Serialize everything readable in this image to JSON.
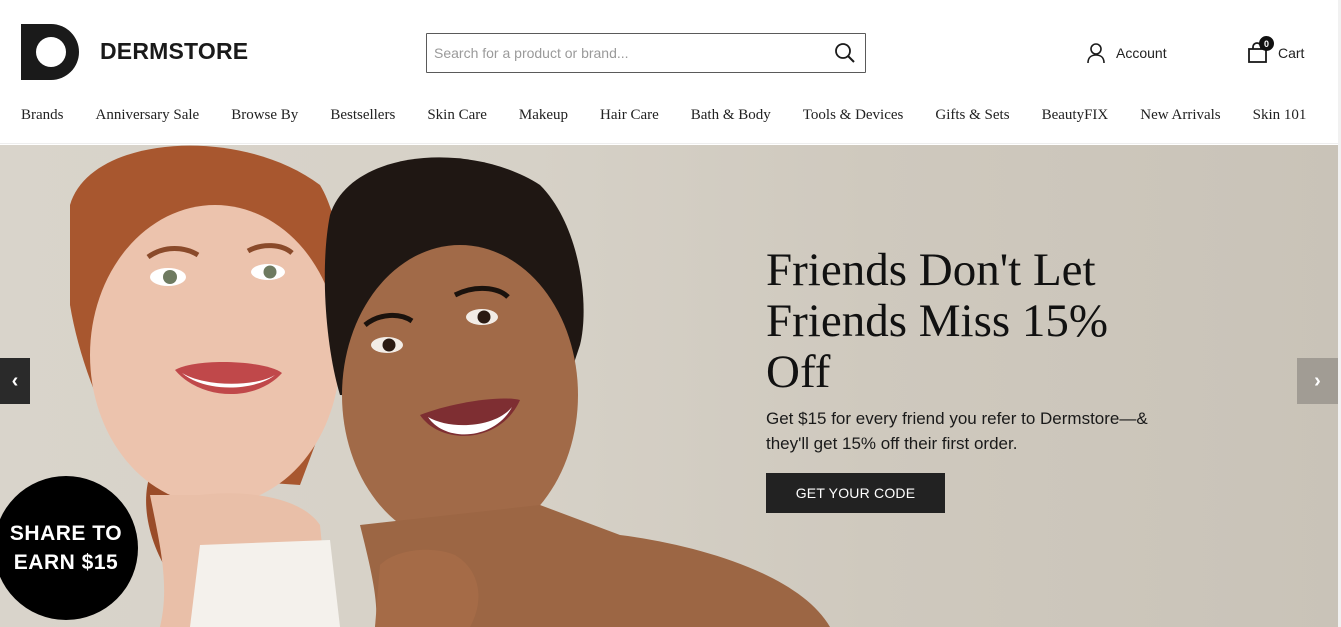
{
  "header": {
    "brand_name": "DERMSTORE",
    "logo_icon": "dermstore-d-logo",
    "search": {
      "placeholder": "Search for a product or brand...",
      "value": "",
      "icon": "search-icon"
    },
    "account_label": "Account",
    "cart_label": "Cart",
    "cart_count": "0"
  },
  "nav": {
    "items": [
      "Brands",
      "Anniversary Sale",
      "Browse By",
      "Bestsellers",
      "Skin Care",
      "Makeup",
      "Hair Care",
      "Bath & Body",
      "Tools & Devices",
      "Gifts & Sets",
      "BeautyFIX",
      "New Arrivals",
      "Skin 101"
    ]
  },
  "hero": {
    "title_line1": "Friends Don't Let",
    "title_line2": "Friends Miss 15%",
    "title_line3": "Off",
    "subtitle_line1": "Get $15 for every friend you refer to Dermstore—&",
    "subtitle_line2": "they'll get 15% off their first order.",
    "cta_label": "GET YOUR CODE",
    "prev_arrow": "‹",
    "next_arrow": "›"
  },
  "share_badge": {
    "line1": "SHARE TO",
    "line2": "EARN $15"
  },
  "colors": {
    "hero_bg": "#d6d1c7",
    "cta_bg": "#222222",
    "badge_bg": "#000000"
  }
}
